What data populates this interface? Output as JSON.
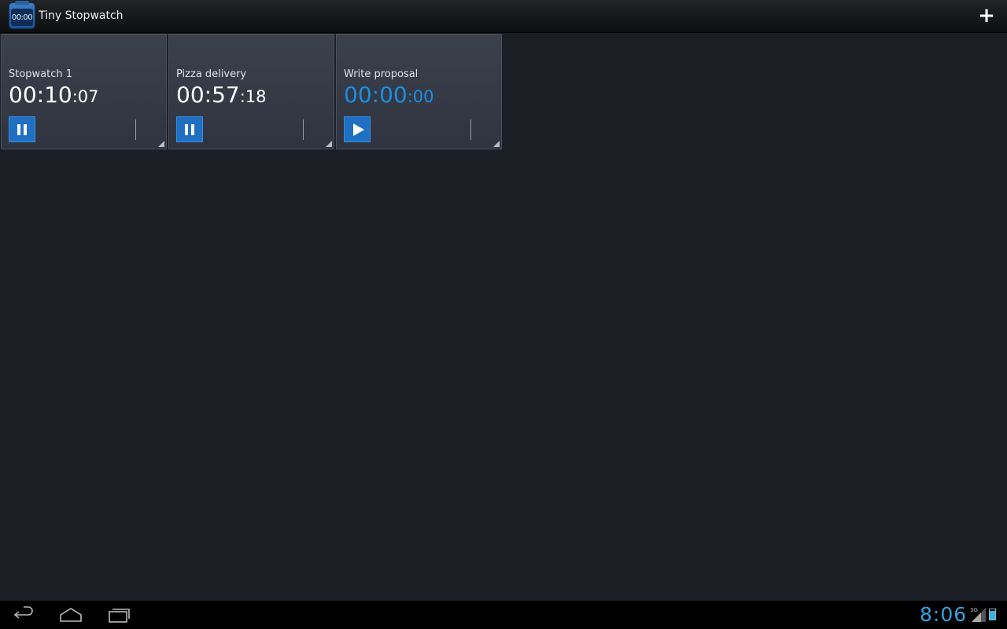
{
  "app": {
    "title": "Tiny Stopwatch",
    "icon_text": "00:00",
    "add_icon": "plus-icon"
  },
  "stopwatches": [
    {
      "name": "Stopwatch 1",
      "time_main": "00:10",
      "time_sec": ":07",
      "state": "running",
      "control_icon": "pause-icon"
    },
    {
      "name": "Pizza delivery",
      "time_main": "00:57",
      "time_sec": ":18",
      "state": "running",
      "control_icon": "pause-icon"
    },
    {
      "name": "Write proposal",
      "time_main": "00:00",
      "time_sec": ":00",
      "state": "stopped",
      "control_icon": "play-icon"
    }
  ],
  "status_bar": {
    "clock": "8:06",
    "network": "3G"
  },
  "colors": {
    "accent": "#1f6fc2",
    "stopped_time": "#1b8ee3",
    "clock": "#3aa0e0"
  }
}
